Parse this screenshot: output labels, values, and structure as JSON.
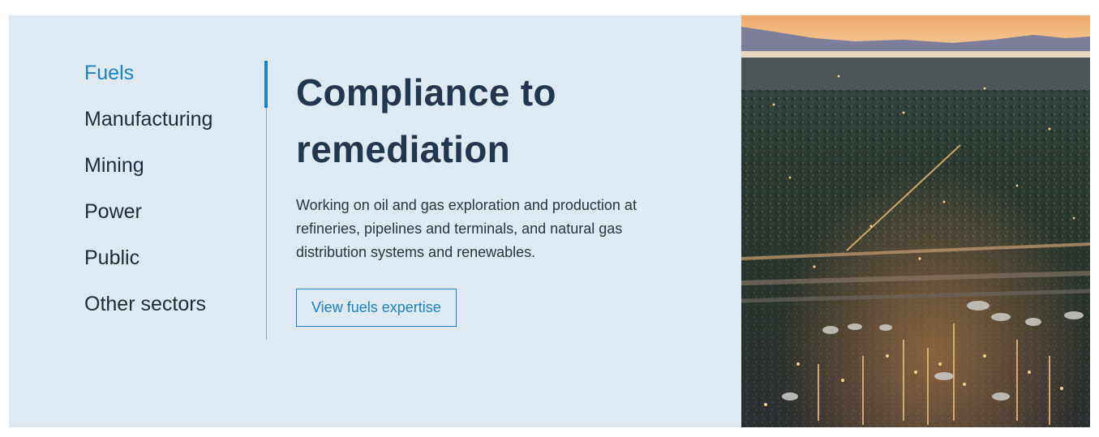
{
  "sector_nav": {
    "items": [
      {
        "label": "Fuels",
        "active": true
      },
      {
        "label": "Manufacturing",
        "active": false
      },
      {
        "label": "Mining",
        "active": false
      },
      {
        "label": "Power",
        "active": false
      },
      {
        "label": "Public",
        "active": false
      },
      {
        "label": "Other sectors",
        "active": false
      }
    ]
  },
  "content": {
    "heading_line1": "Compliance to",
    "heading_line2": "remediation",
    "description": "Working on oil and gas exploration and production at refineries, pipelines and terminals, and natural gas distribution systems and renewables.",
    "cta_label": "View fuels expertise"
  },
  "colors": {
    "panel_background": "#dfe9f2",
    "accent": "#1d82c4",
    "heading": "#22364f"
  }
}
